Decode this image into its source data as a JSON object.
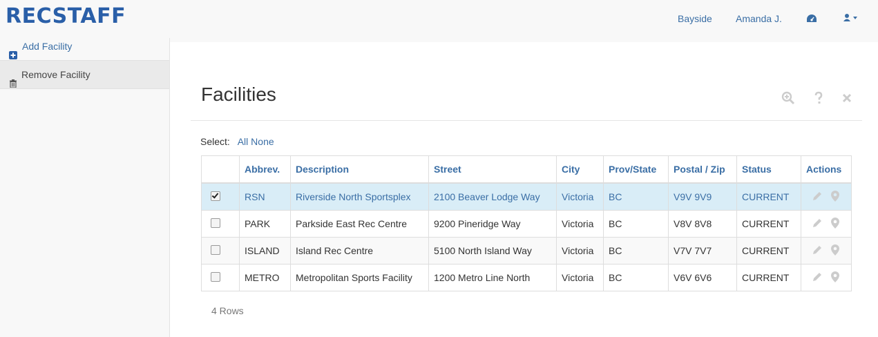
{
  "header": {
    "brand": "RECSTAFF",
    "location": "Bayside",
    "user_name": "Amanda J.",
    "dashboard_icon": "dashboard-icon",
    "account_icon": "user-icon"
  },
  "sidebar": {
    "items": [
      {
        "label": "Add Facility",
        "icon": "plus-square-icon"
      },
      {
        "label": "Remove Facility",
        "icon": "trash-icon"
      }
    ]
  },
  "main": {
    "title": "Facilities",
    "tools": [
      "zoom-in-icon",
      "question-icon",
      "close-icon"
    ],
    "select_label": "Select:",
    "select_all": "All",
    "select_none": "None",
    "columns": [
      "Abbrev.",
      "Description",
      "Street",
      "City",
      "Prov/State",
      "Postal / Zip",
      "Status",
      "Actions"
    ],
    "rows": [
      {
        "checked": true,
        "abbrev": "RSN",
        "description": "Riverside North Sportsplex",
        "street": "2100 Beaver Lodge Way",
        "city": "Victoria",
        "prov": "BC",
        "postal": "V9V 9V9",
        "status": "CURRENT"
      },
      {
        "checked": false,
        "abbrev": "PARK",
        "description": "Parkside East Rec Centre",
        "street": "9200 Pineridge Way",
        "city": "Victoria",
        "prov": "BC",
        "postal": "V8V 8V8",
        "status": "CURRENT"
      },
      {
        "checked": false,
        "abbrev": "ISLAND",
        "description": "Island Rec Centre",
        "street": "5100 North Island Way",
        "city": "Victoria",
        "prov": "BC",
        "postal": "V7V 7V7",
        "status": "CURRENT"
      },
      {
        "checked": false,
        "abbrev": "METRO",
        "description": "Metropolitan Sports Facility",
        "street": "1200 Metro Line North",
        "city": "Victoria",
        "prov": "BC",
        "postal": "V6V 6V6",
        "status": "CURRENT"
      }
    ],
    "row_count": "4 Rows"
  },
  "colors": {
    "brand": "#2a5fa8",
    "link": "#3a6ea5",
    "selected_row": "#d9edf7"
  }
}
